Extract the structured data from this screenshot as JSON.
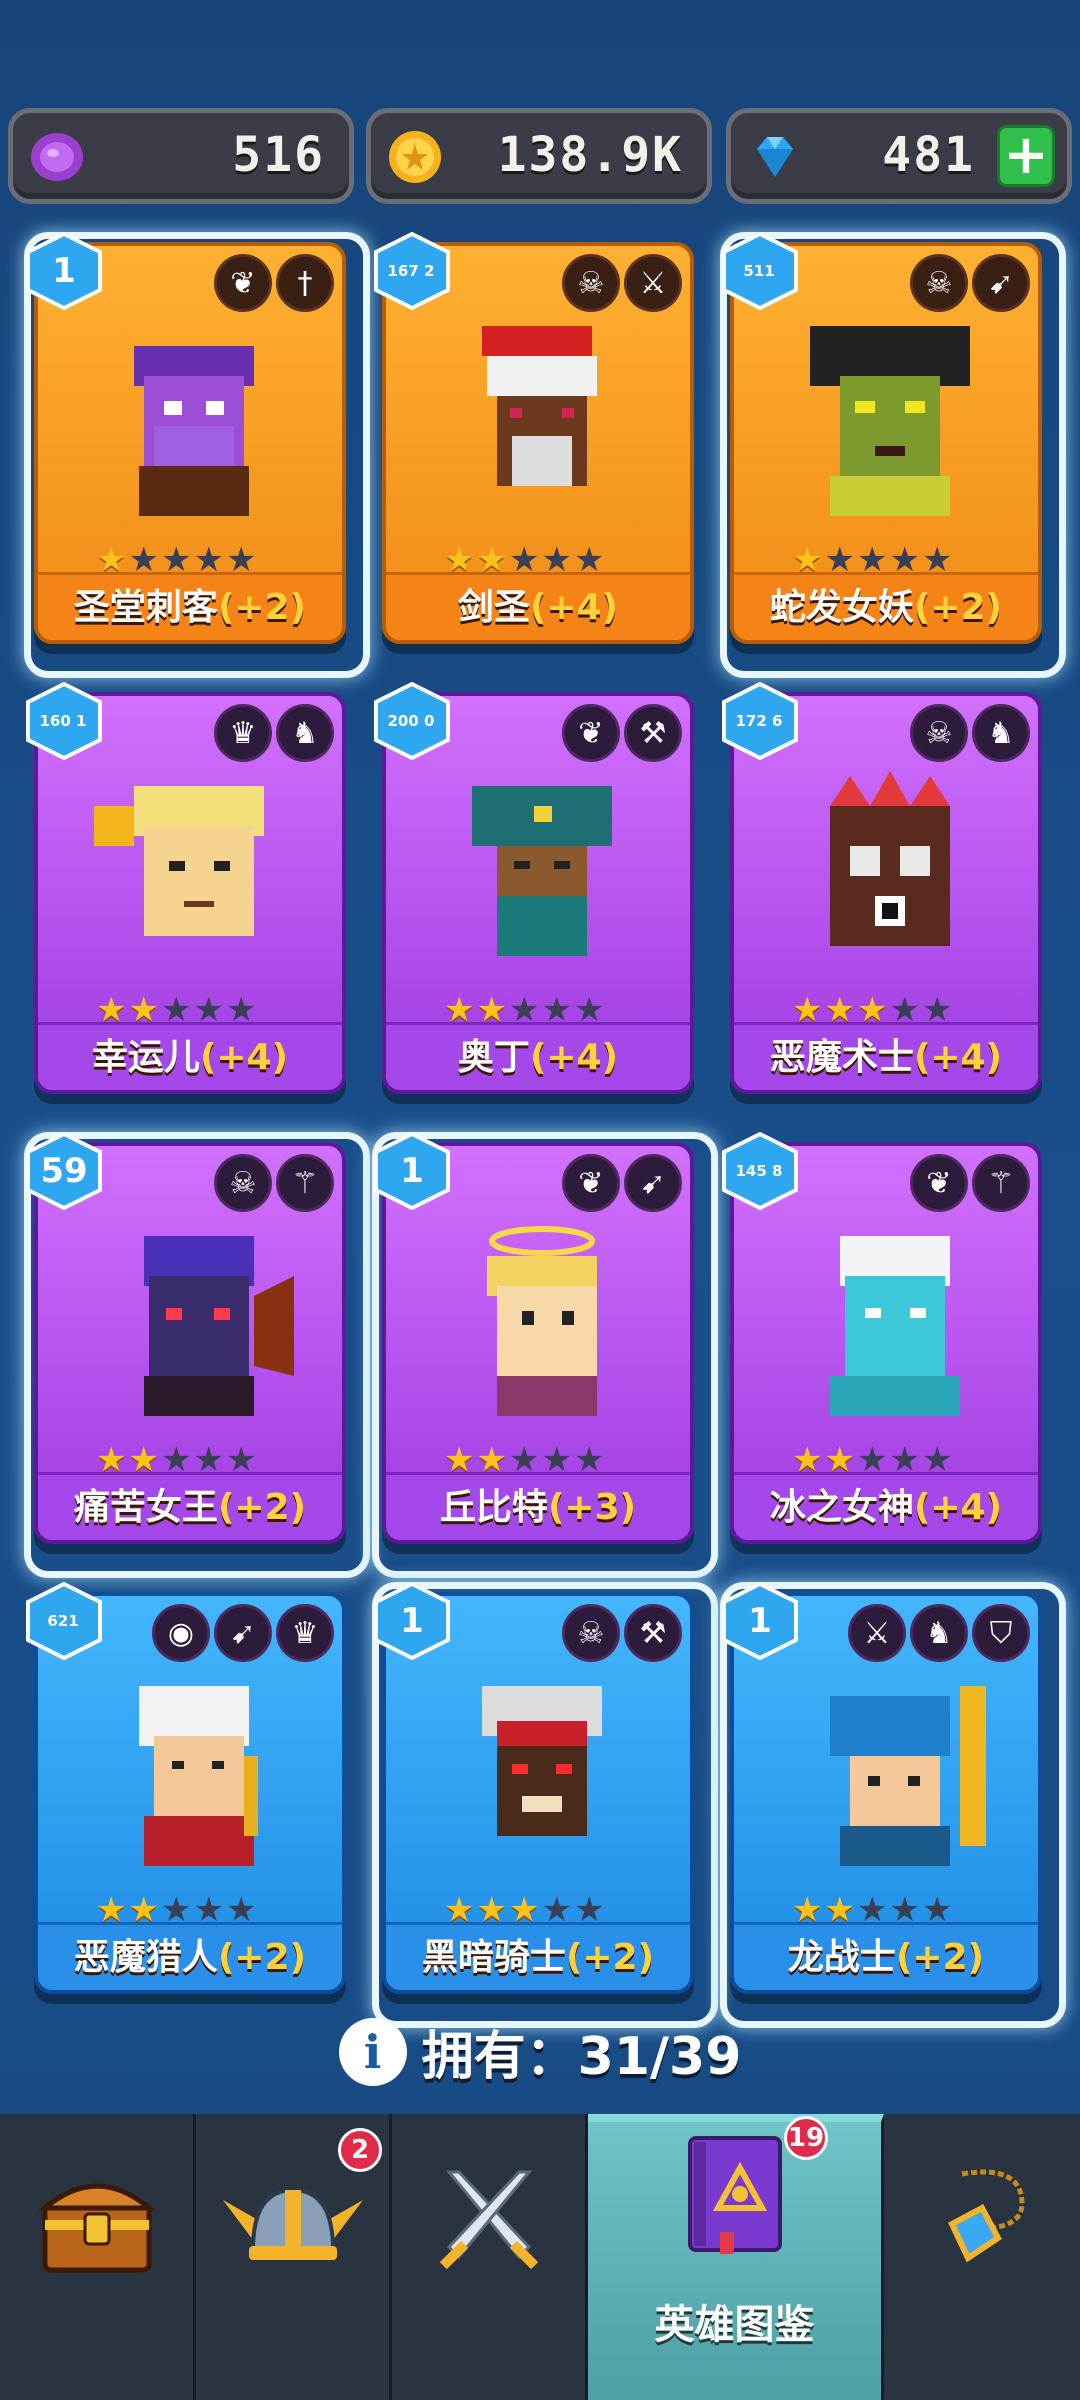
{
  "resources": {
    "purple_coin": "516",
    "gold": "138.9K",
    "gems": "481",
    "purple_icon": "purple-coin-icon",
    "gold_icon": "gold-coin-icon",
    "gem_icon": "gem-icon",
    "plus": "+"
  },
  "heroes": [
    {
      "name": "圣堂刺客",
      "bonus": "(+2)",
      "level": "1",
      "stars": 1,
      "rarity": "orange",
      "classes": [
        "wing-icon",
        "dagger-icon"
      ]
    },
    {
      "name": "剑圣",
      "bonus": "(+4)",
      "level": "167 2",
      "stars": 2,
      "rarity": "orange",
      "classes": [
        "skull-icon",
        "sword-icon"
      ]
    },
    {
      "name": "蛇发女妖",
      "bonus": "(+2)",
      "level": "511",
      "stars": 1,
      "rarity": "orange",
      "classes": [
        "skull-icon",
        "bow-icon"
      ]
    },
    {
      "name": "幸运儿",
      "bonus": "(+4)",
      "level": "160 1",
      "stars": 2,
      "rarity": "purple",
      "classes": [
        "elf-icon",
        "dragon-icon"
      ]
    },
    {
      "name": "奥丁",
      "bonus": "(+4)",
      "level": "200 0",
      "stars": 2,
      "rarity": "purple",
      "classes": [
        "wing-icon",
        "hammer-icon"
      ]
    },
    {
      "name": "恶魔术士",
      "bonus": "(+4)",
      "level": "172 6",
      "stars": 3,
      "rarity": "purple",
      "classes": [
        "skull-icon",
        "dragon-icon"
      ]
    },
    {
      "name": "痛苦女王",
      "bonus": "(+2)",
      "level": "59",
      "stars": 2,
      "rarity": "purple",
      "classes": [
        "skull-icon",
        "staff-icon"
      ]
    },
    {
      "name": "丘比特",
      "bonus": "(+3)",
      "level": "1",
      "stars": 2,
      "rarity": "purple",
      "classes": [
        "wing-icon",
        "bow-icon"
      ]
    },
    {
      "name": "冰之女神",
      "bonus": "(+4)",
      "level": "145 8",
      "stars": 2,
      "rarity": "purple",
      "classes": [
        "wing-icon",
        "staff-icon"
      ]
    },
    {
      "name": "恶魔猎人",
      "bonus": "(+2)",
      "level": "621",
      "stars": 2,
      "rarity": "blue",
      "classes": [
        "eye-icon",
        "bow-icon",
        "elf-icon"
      ]
    },
    {
      "name": "黑暗骑士",
      "bonus": "(+2)",
      "level": "1",
      "stars": 3,
      "rarity": "blue",
      "classes": [
        "skull-icon",
        "hammer-icon"
      ]
    },
    {
      "name": "龙战士",
      "bonus": "(+2)",
      "level": "1",
      "stars": 2,
      "rarity": "blue",
      "classes": [
        "sword-icon",
        "dragon-icon",
        "helmet-icon"
      ]
    }
  ],
  "owned": {
    "label": "拥有：31/39",
    "info_icon": "i"
  },
  "nav": {
    "items": [
      {
        "icon": "treasure-chest-icon"
      },
      {
        "icon": "viking-helmet-icon",
        "badge": "2"
      },
      {
        "icon": "crossed-swords-icon"
      },
      {
        "icon": "hero-book-icon",
        "label": "英雄图鉴",
        "badge": "19"
      },
      {
        "icon": "amulet-icon"
      }
    ]
  },
  "colors": {
    "orange": "#f48418",
    "purple": "#a548ea",
    "blue": "#2a8fe8",
    "bonus": "#ffd23c",
    "nav_active": "#5fb3b8"
  }
}
